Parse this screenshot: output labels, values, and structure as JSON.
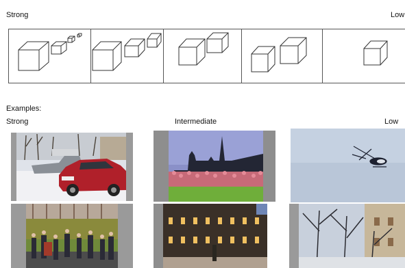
{
  "scale": {
    "left_label": "Strong",
    "right_label": "Low",
    "panels": [
      {
        "cubes": 4
      },
      {
        "cubes": 3
      },
      {
        "cubes": 2
      },
      {
        "cubes": 2
      },
      {
        "cubes": 1
      }
    ]
  },
  "examples": {
    "heading": "Examples:",
    "column_labels": {
      "strong": "Strong",
      "intermediate": "Intermediate",
      "low": "Low"
    },
    "photos": [
      {
        "name": "photo-parked-cars-snow"
      },
      {
        "name": "photo-flowers-church"
      },
      {
        "name": "photo-helicopter-sky"
      },
      {
        "name": "photo-crowd-garden"
      },
      {
        "name": "photo-building-facade"
      },
      {
        "name": "photo-bare-trees-building"
      }
    ]
  },
  "colors": {
    "stroke": "#333333",
    "sky_blue": "#c9d6e6",
    "car_red": "#b0202a"
  }
}
